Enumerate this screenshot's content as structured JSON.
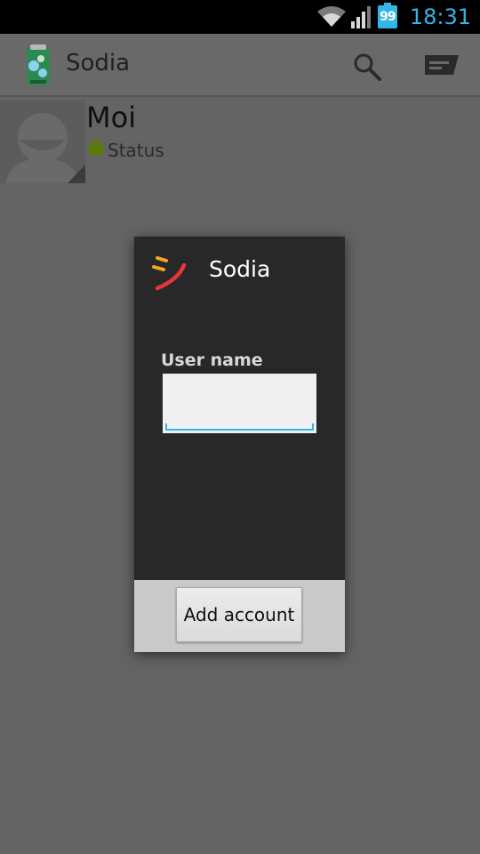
{
  "status_bar": {
    "battery_level": "99",
    "clock": "18:31",
    "icons": [
      "wifi-icon",
      "signal-icon",
      "battery-icon"
    ],
    "accent_color": "#33b5e5"
  },
  "action_bar": {
    "title": "Sodia",
    "icons": [
      "app-logo-icon",
      "search-icon",
      "compose-icon"
    ]
  },
  "profile": {
    "name": "Moi",
    "status": "Status",
    "status_color": "#5a7a10"
  },
  "dialog": {
    "title": "Sodia",
    "field_label": "User name",
    "username_value": "",
    "button_label": "Add account"
  }
}
